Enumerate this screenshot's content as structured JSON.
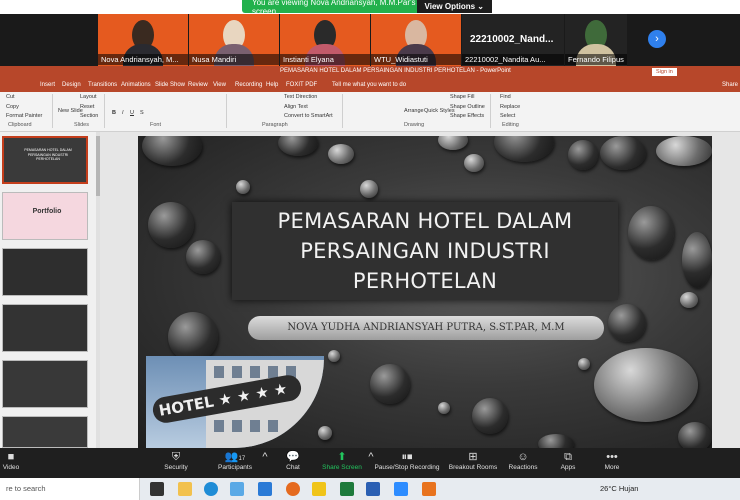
{
  "zoom_banner": {
    "viewing_text": "You are viewing Nova Andriansyah, M.M.Par's screen",
    "view_options": "View Options ⌄"
  },
  "participants": [
    {
      "name": "Nova Andriansyah, M...",
      "kind": "video"
    },
    {
      "name": "Nusa Mandiri",
      "kind": "video"
    },
    {
      "name": "Instianti Elyana",
      "kind": "video"
    },
    {
      "name": "WTU_Widiastuti",
      "kind": "video"
    },
    {
      "name": "22210002_Nandita Au...",
      "big_label": "22210002_Nand...",
      "kind": "name"
    },
    {
      "name": "Fernando Filipus",
      "kind": "video"
    }
  ],
  "powerpoint": {
    "window_title": "PEMASARAN HOTEL DALAM PERSAINGAN INDUSTRI PERHOTELAN  -  PowerPoint",
    "sign_in": "Sign in",
    "menu_tabs": [
      "Insert",
      "Design",
      "Transitions",
      "Animations",
      "Slide Show",
      "Review",
      "View",
      "Recording",
      "Help",
      "FOXIT PDF",
      "Tell me what you want to do",
      "Share"
    ],
    "ribbon": {
      "clipboard": {
        "cut": "Cut",
        "copy": "Copy",
        "format_painter": "Format Painter",
        "label": "Clipboard"
      },
      "slides": {
        "new_slide": "New Slide",
        "layout": "Layout",
        "reset": "Reset",
        "section": "Section",
        "label": "Slides"
      },
      "font": {
        "label": "Font"
      },
      "paragraph": {
        "text_direction": "Text Direction",
        "align_text": "Align Text",
        "convert_smartart": "Convert to SmartArt",
        "label": "Paragraph"
      },
      "drawing": {
        "arrange": "Arrange",
        "quick_styles": "Quick Styles",
        "shape_fill": "Shape Fill",
        "shape_outline": "Shape Outline",
        "shape_effects": "Shape Effects",
        "label": "Drawing"
      },
      "editing": {
        "find": "Find",
        "replace": "Replace",
        "select": "Select",
        "label": "Editing"
      }
    },
    "thumbnails": [
      {
        "text": "PEMASARAN HOTEL DALAM PERSAINGAN INDUSTRI PERHOTELAN",
        "color": "#3a3a3a"
      },
      {
        "text": "Portfolio",
        "color": "#f5d7df"
      },
      {
        "text": "",
        "color": "#2e2e2e"
      },
      {
        "text": "",
        "color": "#333333"
      },
      {
        "text": "",
        "color": "#383838"
      },
      {
        "text": "",
        "color": "#3a3a3a"
      }
    ],
    "slide": {
      "title": "PEMASARAN HOTEL DALAM PERSAINGAN INDUSTRI PERHOTELAN",
      "subtitle": "NOVA YUDHA ANDRIANSYAH PUTRA, S.ST.PAR, M.M",
      "sign_text": "HOTEL ★ ★ ★ ★"
    }
  },
  "zoom_controls": {
    "video": "Video",
    "security": "Security",
    "participants": "Participants",
    "participants_count": "17",
    "chat": "Chat",
    "share_screen": "Share Screen",
    "pause_recording": "Pause/Stop Recording",
    "breakout_rooms": "Breakout Rooms",
    "reactions": "Reactions",
    "apps": "Apps",
    "more": "More"
  },
  "taskbar": {
    "search_placeholder": "re to search",
    "weather": "26°C  Hujan"
  }
}
